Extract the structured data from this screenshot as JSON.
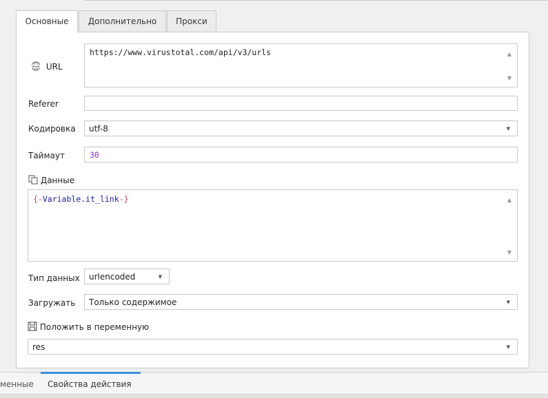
{
  "tabs": [
    {
      "label": "Основные",
      "active": true
    },
    {
      "label": "Дополнительно",
      "active": false
    },
    {
      "label": "Прокси",
      "active": false
    }
  ],
  "url": {
    "label": "URL",
    "value": "https://www.virustotal.com/api/v3/urls",
    "icon": "globe-www-icon"
  },
  "referer": {
    "label": "Referer",
    "value": ""
  },
  "encoding": {
    "label": "Кодировка",
    "value": "utf-8"
  },
  "timeout": {
    "label": "Таймаут",
    "value": "30"
  },
  "data_section": {
    "label": "Данные",
    "icon": "copy-icon",
    "value_open": "{-",
    "value_var": "Variable.it_link",
    "value_close": "-}"
  },
  "data_type": {
    "label": "Тип данных",
    "value": "urlencoded"
  },
  "load": {
    "label": "Загружать",
    "value": "Только содержимое"
  },
  "save_to_var": {
    "label": "Положить в переменную",
    "value": "res",
    "icon": "save-icon"
  },
  "bottom_tabs": [
    {
      "label": "менные",
      "active": false
    },
    {
      "label": "Свойства действия",
      "active": true
    }
  ],
  "colors": {
    "accent": "#3b8ed8",
    "var_brace": "#d04040",
    "var_name": "#1a1aa6",
    "number": "#8a2be2"
  }
}
